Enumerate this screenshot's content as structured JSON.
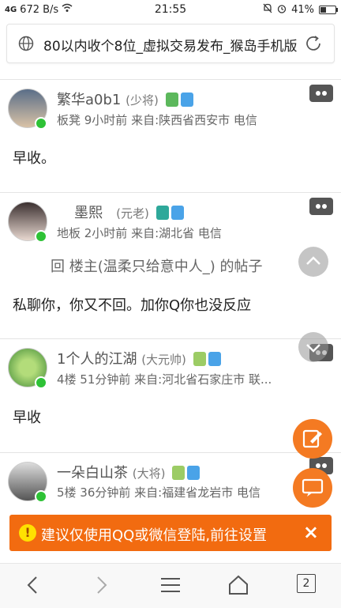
{
  "status": {
    "signal": "4G",
    "speed": "672 B/s",
    "time": "21:55",
    "battery": "41%"
  },
  "browser": {
    "title": "80以内收个8位_虚拟交易发布_猴岛手机版",
    "tab_count": "2"
  },
  "posts": [
    {
      "name": "繁华a0b1",
      "rank": "(少将)",
      "meta": "板凳   9小时前 来自:陕西省西安市 电信",
      "text": "早收。"
    },
    {
      "name": "墨熙",
      "rank": "(元老)",
      "meta": "地板   2小时前 来自:湖北省 电信",
      "quote": "回 楼主(温柔只给意中人_) 的帖子",
      "text": "私聊你，你又不回。加你Q你也没反应"
    },
    {
      "name": "1个人的江湖",
      "rank": "(大元帅)",
      "meta": "4楼   51分钟前 来自:河北省石家庄市 联...",
      "text": "早收"
    },
    {
      "name": "一朵白山茶",
      "rank": "(大将)",
      "meta": "5楼   36分钟前 来自:福建省龙岩市 电信"
    }
  ],
  "toast": {
    "text": "建议仅使用QQ或微信登陆,前往设置",
    "close": "×",
    "warn": "!"
  },
  "colors": {
    "accent": "#f26b10",
    "online": "#2ec236"
  }
}
